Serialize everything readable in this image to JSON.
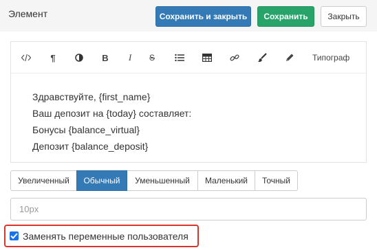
{
  "header": {
    "title": "Элемент",
    "save_close_label": "Сохранить и закрыть",
    "save_label": "Сохранить",
    "close_label": "Закрыть"
  },
  "toolbar": {
    "typograf_label": "Типограф",
    "bold_label": "B",
    "italic_label": "I",
    "strike_label": "S",
    "paragraph_label": "¶"
  },
  "content": {
    "lines": [
      "Здравствуйте, {first_name}",
      "Ваш депозит на {today} составляет:",
      "Бонусы {balance_virtual}",
      "Депозит {balance_deposit}"
    ]
  },
  "size_options": [
    {
      "label": "Увеличенный"
    },
    {
      "label": "Обычный"
    },
    {
      "label": "Уменьшенный"
    },
    {
      "label": "Маленький"
    },
    {
      "label": "Точный"
    }
  ],
  "size_selected": "Обычный",
  "size_input": {
    "placeholder": "10px"
  },
  "replace_vars": {
    "label": "Заменять переменные пользователя",
    "checked": true
  },
  "colors": {
    "primary": "#337ab7",
    "success": "#28a36a",
    "highlight_border": "#d9342b",
    "checkbox": "#1a73e8"
  }
}
